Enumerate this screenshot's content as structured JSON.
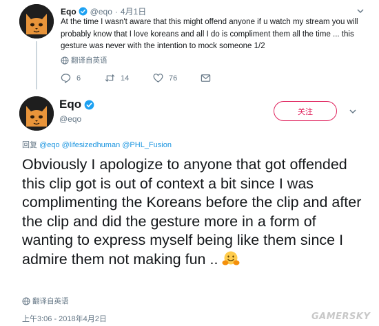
{
  "tweet1": {
    "name": "Eqo",
    "handle": "@eqo",
    "separator": "·",
    "date": "4月1日",
    "text": "At the time I wasn't aware that this might offend anyone if u watch my stream you will probably know that I love koreans and all I do is compliment them all the time ... this gesture was never with the intention to mock someone 1/2",
    "translate": "翻译自英语",
    "replies": "6",
    "retweets": "14",
    "likes": "76"
  },
  "tweet2": {
    "name": "Eqo",
    "handle": "@eqo",
    "follow_label": "关注",
    "reply_prefix": "回复",
    "mentions": [
      "@eqo",
      "@lifesizedhuman",
      "@PHL_Fusion"
    ],
    "text": "Obviously I apologize to anyone that got offended this clip got is out of context a bit since I was complimenting the Koreans before the clip and after the clip and did the gesture more in a form of wanting to express myself being like them since I admire them not making fun ..",
    "translate": "翻译自英语",
    "timestamp": "上午3:06 - 2018年4月2日"
  },
  "watermark": "GAMERSKY",
  "colors": {
    "accent_blue": "#1da1f2",
    "follow_red": "#e0245e",
    "gray_text": "#657786"
  },
  "icons": [
    "verified-icon",
    "chevron-down-icon",
    "globe-icon",
    "reply-icon",
    "retweet-icon",
    "like-icon",
    "dm-icon",
    "hugging-emoji"
  ]
}
